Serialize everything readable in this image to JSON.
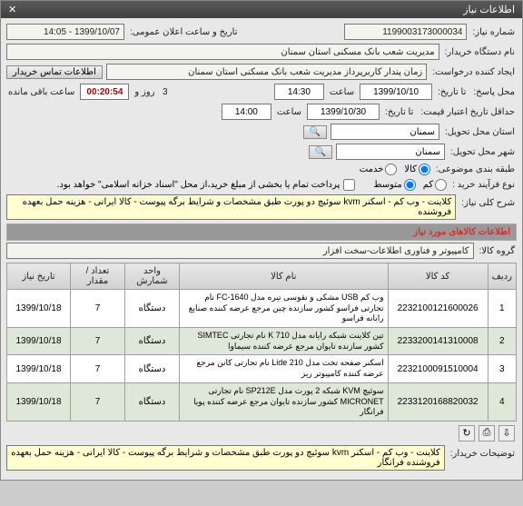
{
  "title": "اطلاعات نیاز",
  "labels": {
    "need_no": "شماره نیاز:",
    "public_date": "تاریخ و ساعت اعلان عمومی:",
    "buyer_org": "نام دستگاه خریدار:",
    "creator": "ایجاد کننده درخواست:",
    "creator_time": "زمان پندار کاربرپرداز مدیریت شعب بانک مسکنی استان سمنان",
    "contact_btn": "اطلاعات تماس خریدار",
    "response_deadline": "محل پاسخ:",
    "date": "تاریخ",
    "time": "ساعت",
    "validity_deadline": "حداقل تاریخ اعتبار قیمت:",
    "to_date": "تا تاریخ:",
    "remaining": "ساعت باقی مانده",
    "and_days": "روز و",
    "delivery_state": "استان محل تحویل:",
    "delivery_city": "شهر محل تحویل:",
    "classification": "طبقه بندی موضوعی:",
    "goods": "کالا",
    "service": "خدمت",
    "process_type": "نوع فرآیند خرید :",
    "low": "کم",
    "medium": "متوسط",
    "payment_note_chk": "پرداخت تمام یا بخشی از مبلغ خرید،از محل \"اسناد خزانه اسلامی\" خواهد بود.",
    "overall_title": "شرح کلی نیاز:",
    "items_section": "اطلاعات کالاهای مورد نیاز",
    "goods_group": "گروه کالا:",
    "col_row": "ردیف",
    "col_code": "کد کالا",
    "col_name": "نام کالا",
    "col_unit": "واحد شمارش",
    "col_qty": "تعداد / مقدار",
    "col_due": "تاریخ نیاز",
    "buyer_notes": "توضیحات خریدار:"
  },
  "values": {
    "need_no": "1199003173000034",
    "public_date": "1399/10/07 - 14:05",
    "buyer_org": "مدیریت شعب بانک مسکنی استان سمنان",
    "resp_date": "1399/10/10",
    "resp_time": "14:30",
    "valid_date": "1399/10/30",
    "valid_time": "14:00",
    "remaining_time": "00:20:54",
    "remaining_days": "3",
    "state": "سمنان",
    "city": "سمنان",
    "class_sel": "goods",
    "process_sel": "medium",
    "overall_desc": "کلاینت - وب کم - اسکنر kvm سوئیچ دو پورت طبق مشخصات و شرایط برگه پیوست - کالا ایرانی - هزینه حمل بعهده فروشنده",
    "goods_group": "کامپیوتر و فناوری اطلاعات-سخت افزار",
    "buyer_notes": "کلاینت - وب کم - اسکنر kvm سوئیچ دو پورت طبق مشخصات و شرایط برگه پیوست - کالا ایرانی - هزینه حمل بعهده فروشنده فرانگار"
  },
  "items": [
    {
      "row": "1",
      "code": "2232100121600026",
      "name": "وب کم USB مشکی و نقوسی تیره مدل FC-1640 نام تجارتی فراسو کشور سازنده چین مرجع عرضه کننده صنایع رایانه فراسو",
      "unit": "دستگاه",
      "qty": "7",
      "due": "1399/10/18"
    },
    {
      "row": "2",
      "code": "2233200141310008",
      "name": "تین کلاینت شبکه رایانه مدل K 710 نام تجارتی SIMTEC کشور سازنده تایوان مرجع عرضه کننده سیماوا",
      "unit": "دستگاه",
      "qty": "7",
      "due": "1399/10/18"
    },
    {
      "row": "3",
      "code": "2232100091510004",
      "name": "اسکنر صفحه تخت مدل Lide 210 نام تجارتی کانن مرجع عرضه کننده کامپیوتر ریز",
      "unit": "دستگاه",
      "qty": "7",
      "due": "1399/10/18"
    },
    {
      "row": "4",
      "code": "2233120168820032",
      "name": "سوئیچ KVM شبکه 2 پورت مدل SP212E نام تجارتی MICRONET کشور سازنده تایوان مرجع عرضه کننده پویا فرانگار",
      "unit": "دستگاه",
      "qty": "7",
      "due": "1399/10/18"
    }
  ]
}
